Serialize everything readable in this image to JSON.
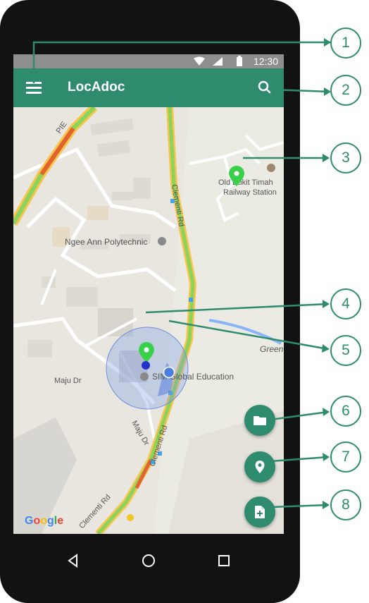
{
  "status_bar": {
    "time": "12:30"
  },
  "toolbar": {
    "title": "LocAdoc"
  },
  "map": {
    "labels": {
      "pie": "PIE",
      "ngee_ann": "Ngee Ann Polytechnic",
      "old_bukit_timah_1": "Old Bukit Timah",
      "old_bukit_timah_2": "Railway Station",
      "clementi_rd_1": "Clementi Rd",
      "clementi_rd_2": "Clementi Rd",
      "clementi_rd_3": "Clementi Rd",
      "maju_dr_1": "Maju Dr",
      "maju_dr_2": "Maju Dr",
      "green": "Green",
      "education": "SIM Global Education"
    },
    "google_logo": "Google"
  },
  "fabs": {
    "folder": "folder-icon",
    "location": "location-pin-icon",
    "add_document": "add-document-icon"
  },
  "callouts": [
    "1",
    "2",
    "3",
    "4",
    "5",
    "6",
    "7",
    "8"
  ],
  "colors": {
    "primary": "#2e8b6e",
    "pin_green": "#39d14a",
    "user_dot": "#4a7fe0",
    "road_highlight": "#8bd35a"
  }
}
